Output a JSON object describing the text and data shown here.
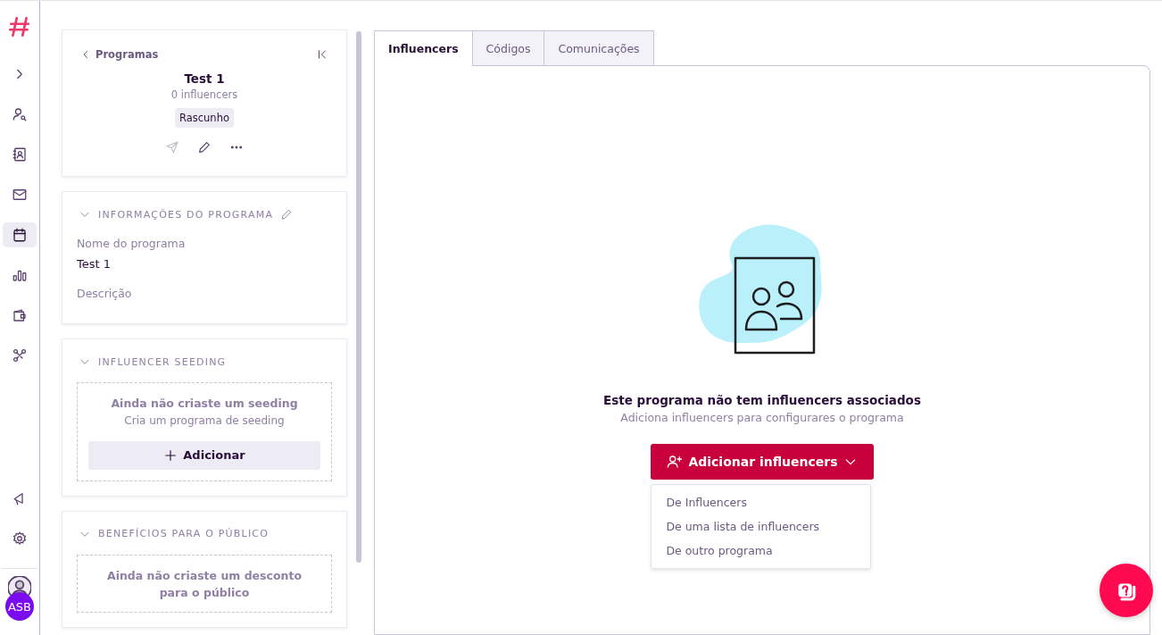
{
  "sidebar": {
    "items": [
      {
        "kind": "expand",
        "selected": false
      },
      {
        "kind": "user-search",
        "selected": false
      },
      {
        "kind": "contacts",
        "selected": false
      },
      {
        "kind": "mail",
        "selected": false
      },
      {
        "kind": "calendar",
        "selected": true
      },
      {
        "kind": "chart",
        "selected": false
      },
      {
        "kind": "wallet",
        "selected": false
      },
      {
        "kind": "nodes",
        "selected": false
      }
    ],
    "bottom": [
      {
        "kind": "megaphone"
      },
      {
        "kind": "gear"
      }
    ],
    "user_initials": "ASB"
  },
  "program_card": {
    "back": "Programas",
    "title": "Test 1",
    "subtitle": "0 influencers",
    "status": "Rascunho"
  },
  "info": {
    "title": "INFORMAÇÕES DO PROGRAMA",
    "fields": [
      {
        "label": "Nome do programa",
        "value": "Test 1"
      },
      {
        "label": "Descrição"
      }
    ]
  },
  "seeding": {
    "title": "INFLUENCER SEEDING",
    "empty_title": "Ainda não criaste um seeding",
    "empty_text": "Cria um programa de seeding",
    "button": "Adicionar"
  },
  "benefits": {
    "title": "BENEFÍCIOS PARA O PÚBLICO",
    "empty_title": "Ainda não criaste um desconto para o público"
  },
  "tabs": [
    {
      "label": "Influencers",
      "selected": true
    },
    {
      "label": "Códigos",
      "selected": false
    },
    {
      "label": "Comunicações",
      "selected": false
    }
  ],
  "empty_state": {
    "title": "Este programa não tem influencers associados",
    "text": "Adiciona influencers para configurares o programa",
    "button": "Adicionar influencers",
    "menu": [
      "De Influencers",
      "De uma lista de influencers",
      "De outro programa"
    ]
  }
}
